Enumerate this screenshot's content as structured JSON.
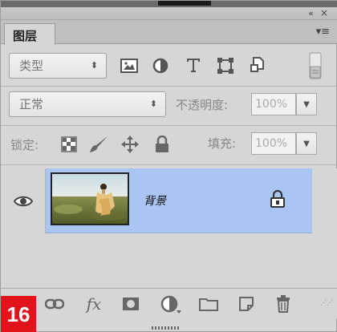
{
  "panel": {
    "tab_label": "图层",
    "collapse_glyph": "«",
    "close_glyph": "×",
    "menu_glyph": "▾≡"
  },
  "filter": {
    "kind_label": "类型",
    "icons": [
      "image-filter-icon",
      "adjustment-filter-icon",
      "type-filter-icon",
      "shape-filter-icon",
      "smart-object-filter-icon"
    ]
  },
  "blend": {
    "mode_label": "正常",
    "opacity_label": "不透明度:",
    "opacity_value": "100%"
  },
  "lock": {
    "lock_label": "锁定:",
    "fill_label": "填充:",
    "fill_value": "100%"
  },
  "layers": [
    {
      "name": "背景",
      "visible": true,
      "locked": true,
      "selected": true
    }
  ],
  "bottom_toolbar": {
    "fx_label": "fx",
    "step_number": "16"
  },
  "colors": {
    "panel_bg": "#d6d6d6",
    "selected_layer": "#a9c5f2",
    "badge": "#e3131b"
  }
}
